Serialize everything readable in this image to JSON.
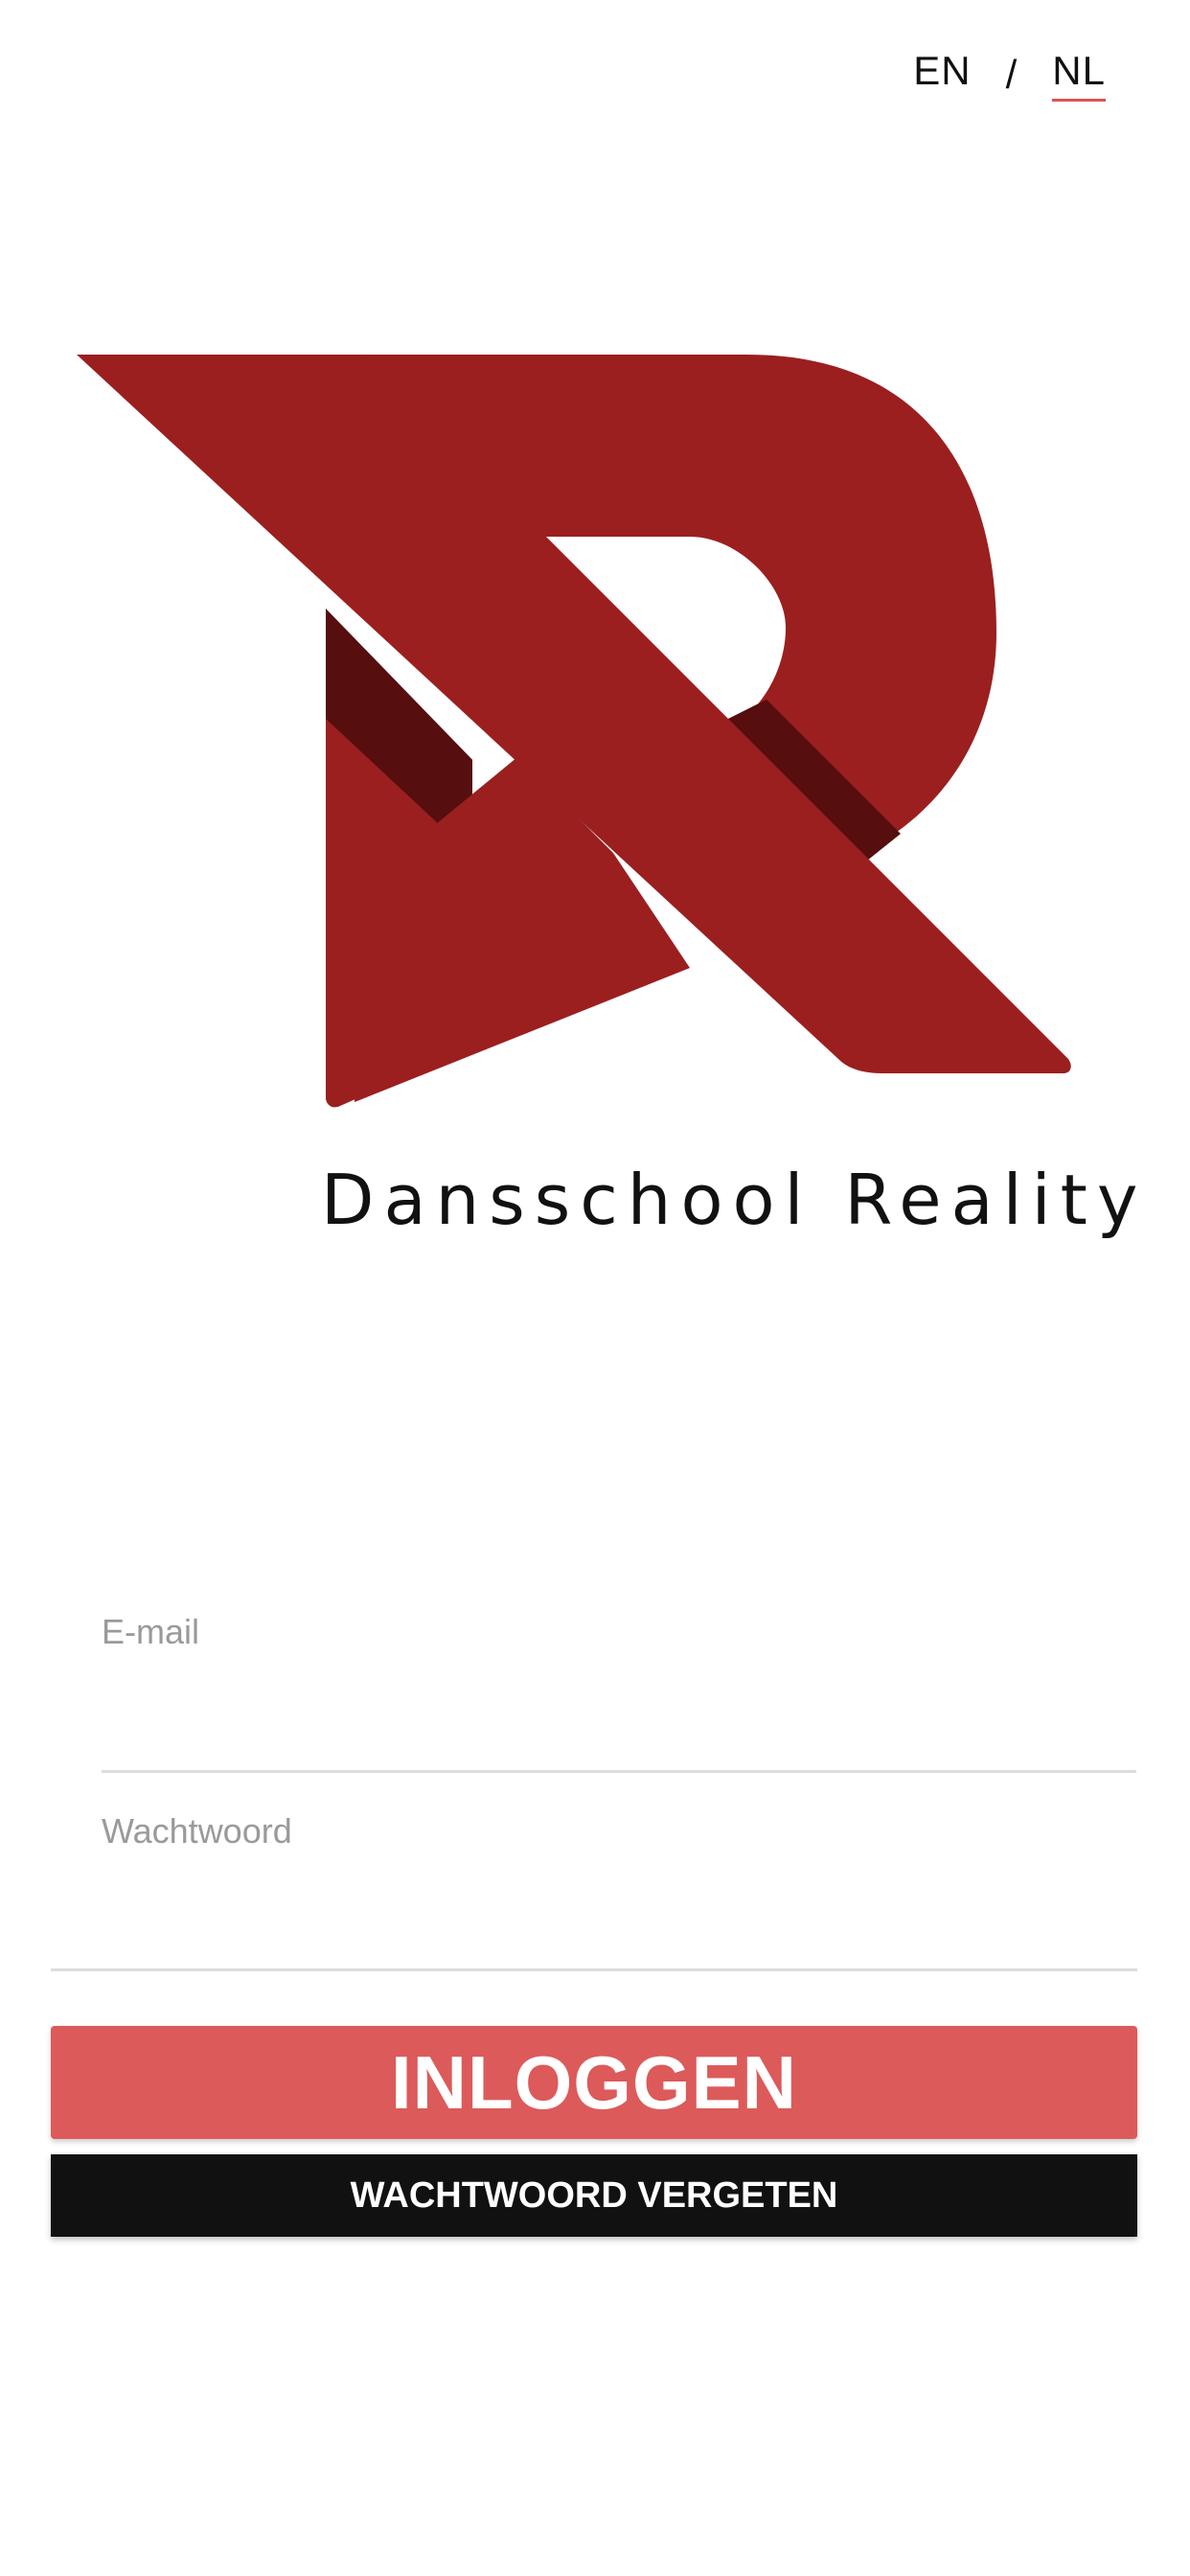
{
  "language_switch": {
    "en_label": "EN",
    "separator": "/",
    "nl_label": "NL",
    "active": "NL"
  },
  "logo": {
    "icon": "dansschool-reality-r-logo-icon",
    "text": "Dansschool Reality",
    "primary_color": "#9b1f1f",
    "shadow_color": "#560e0e"
  },
  "login_form": {
    "email_label": "E-mail",
    "email_value": "",
    "password_label": "Wachtwoord",
    "password_value": ""
  },
  "buttons": {
    "login_label": "INLOGGEN",
    "login_color": "#dc5a5a",
    "forgot_password_label": "WACHTWOORD VERGETEN",
    "forgot_password_color": "#111111"
  }
}
